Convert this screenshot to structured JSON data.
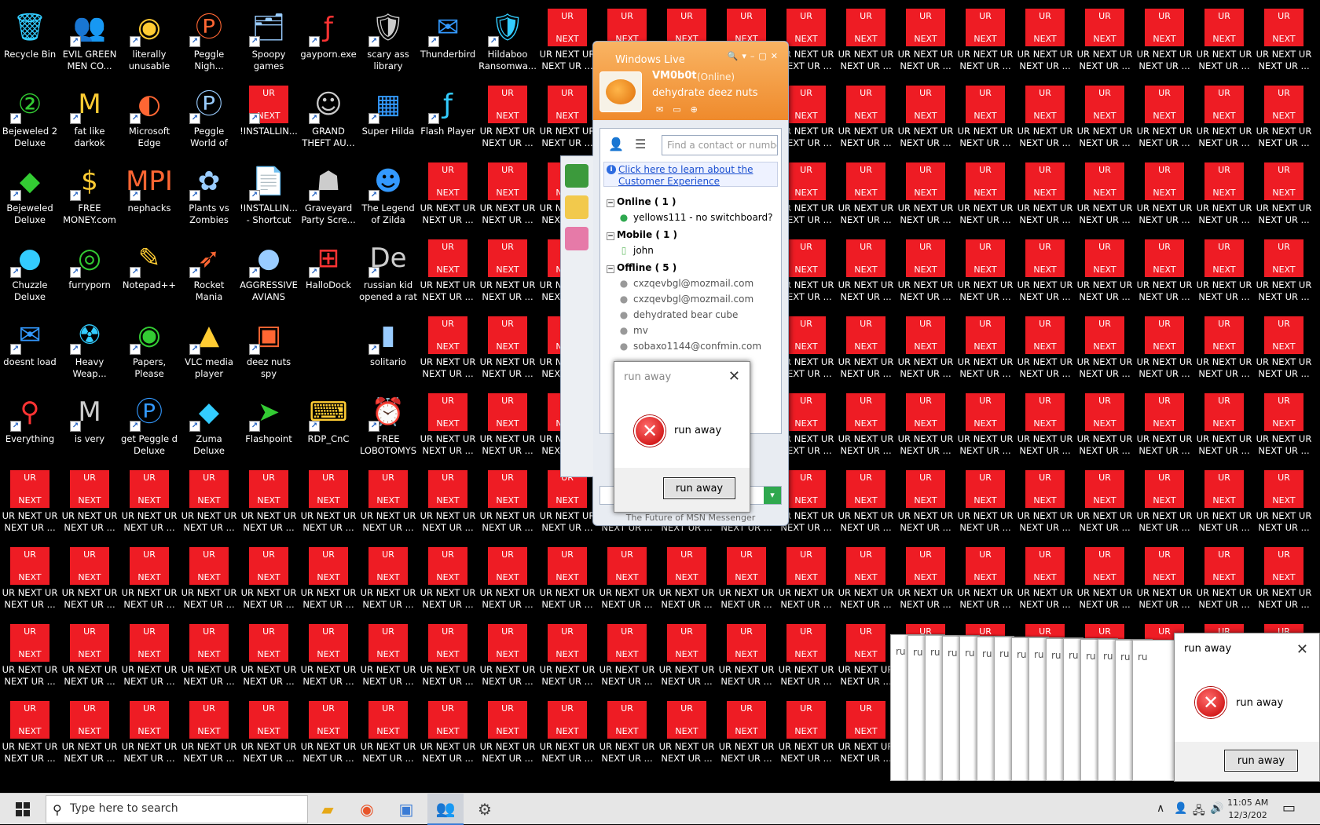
{
  "desktop_icons_named": [
    {
      "label": "Recycle Bin",
      "glyph": "🗑",
      "icon": "recycle-bin-icon",
      "c": 0,
      "r": 0,
      "shortcut": false
    },
    {
      "label": "EVIL GREEN MEN CO...",
      "glyph": "👥",
      "icon": "green-men-icon",
      "c": 1,
      "r": 0
    },
    {
      "label": "literally unusable",
      "glyph": "◉",
      "icon": "chrome-icon",
      "c": 2,
      "r": 0
    },
    {
      "label": "Peggle Nigh...",
      "glyph": "Ⓟ",
      "icon": "peggle-icon",
      "c": 3,
      "r": 0
    },
    {
      "label": "Spoopy games",
      "glyph": "🗂",
      "icon": "folder-icon",
      "c": 4,
      "r": 0
    },
    {
      "label": "gayporn.exe",
      "glyph": "ƒ",
      "icon": "flash-icon",
      "c": 5,
      "r": 0
    },
    {
      "label": "scary ass library",
      "glyph": "🛡",
      "icon": "library-icon",
      "c": 6,
      "r": 0
    },
    {
      "label": "Thunderbird",
      "glyph": "✉",
      "icon": "thunderbird-icon",
      "c": 7,
      "r": 0
    },
    {
      "label": "Hildaboo Ransomwa...",
      "glyph": "🛡",
      "icon": "yashma-icon",
      "c": 8,
      "r": 0
    },
    {
      "label": "Bejeweled 2 Deluxe",
      "glyph": "②",
      "icon": "bejeweled2-icon",
      "c": 0,
      "r": 1
    },
    {
      "label": "fat like darkok",
      "glyph": "M",
      "icon": "mahjong-icon",
      "c": 1,
      "r": 1
    },
    {
      "label": "Microsoft Edge",
      "glyph": "◐",
      "icon": "edge-icon",
      "c": 2,
      "r": 1
    },
    {
      "label": "Peggle World of Warcraft ...",
      "glyph": "Ⓟ",
      "icon": "peggle-wow-icon",
      "c": 3,
      "r": 1
    },
    {
      "label": "!INSTALLIN...",
      "glyph": "UR",
      "icon": "ur-next-icon",
      "c": 4,
      "r": 1
    },
    {
      "label": "GRAND THEFT AU...",
      "glyph": "☺",
      "icon": "anime-icon",
      "c": 5,
      "r": 1
    },
    {
      "label": "Super Hilda",
      "glyph": "▦",
      "icon": "pixel-icon",
      "c": 6,
      "r": 1
    },
    {
      "label": "Flash Player",
      "glyph": "ƒ",
      "icon": "flash-player-icon",
      "c": 7,
      "r": 1
    },
    {
      "label": "Bejeweled Deluxe",
      "glyph": "◆",
      "icon": "bejeweled-icon",
      "c": 0,
      "r": 2
    },
    {
      "label": "FREE MONEY.com",
      "glyph": "$",
      "icon": "money-bag-icon",
      "c": 1,
      "r": 2
    },
    {
      "label": "nephacks",
      "glyph": "MPI",
      "icon": "mpi-icon",
      "c": 2,
      "r": 2
    },
    {
      "label": "Plants vs Zombies",
      "glyph": "✿",
      "icon": "pvz-icon",
      "c": 3,
      "r": 2
    },
    {
      "label": "!INSTALLIN... - Shortcut",
      "glyph": "📄",
      "icon": "document-icon",
      "c": 4,
      "r": 2
    },
    {
      "label": "Graveyard Party Scre...",
      "glyph": "☗",
      "icon": "graveyard-icon",
      "c": 5,
      "r": 2
    },
    {
      "label": "The Legend of Zilda",
      "glyph": "☻",
      "icon": "zelda-icon",
      "c": 6,
      "r": 2
    },
    {
      "label": "Chuzzle Deluxe",
      "glyph": "●",
      "icon": "chuzzle-icon",
      "c": 0,
      "r": 3
    },
    {
      "label": "furryporn",
      "glyph": "◎",
      "icon": "firefox-icon",
      "c": 1,
      "r": 3
    },
    {
      "label": "Notepad++",
      "glyph": "✎",
      "icon": "notepad-icon",
      "c": 2,
      "r": 3
    },
    {
      "label": "Rocket Mania Deluxe",
      "glyph": "➶",
      "icon": "rocket-icon",
      "c": 3,
      "r": 3
    },
    {
      "label": "AGGRESSIVE AVIANS",
      "glyph": "●",
      "icon": "angry-birds-icon",
      "c": 4,
      "r": 3
    },
    {
      "label": "HalloDock",
      "glyph": "⊞",
      "icon": "windows-shield-icon",
      "c": 5,
      "r": 3
    },
    {
      "label": "russian kid opened a rat",
      "glyph": "De",
      "icon": "de-icon",
      "c": 6,
      "r": 3
    },
    {
      "label": "doesnt load",
      "glyph": "✉",
      "icon": "mail-icon",
      "c": 0,
      "r": 4
    },
    {
      "label": "Heavy Weap...",
      "glyph": "☢",
      "icon": "radiation-icon",
      "c": 1,
      "r": 4
    },
    {
      "label": "Papers, Please",
      "glyph": "◉",
      "icon": "papers-please-icon",
      "c": 2,
      "r": 4
    },
    {
      "label": "VLC media player",
      "glyph": "▲",
      "icon": "vlc-icon",
      "c": 3,
      "r": 4
    },
    {
      "label": "deez nuts spy",
      "glyph": "▣",
      "icon": "windows-stack-icon",
      "c": 4,
      "r": 4
    },
    {
      "label": "solitario",
      "glyph": "▮",
      "icon": "solitaire-icon",
      "c": 6,
      "r": 4
    },
    {
      "label": "Everything",
      "glyph": "⚲",
      "icon": "everything-icon",
      "c": 0,
      "r": 5
    },
    {
      "label": "is very",
      "glyph": "M",
      "icon": "mw-icon",
      "c": 1,
      "r": 5
    },
    {
      "label": "get Peggle d Deluxe",
      "glyph": "Ⓟ",
      "icon": "peggle-deluxe-icon",
      "c": 2,
      "r": 5
    },
    {
      "label": "Zuma Deluxe",
      "glyph": "◆",
      "icon": "zuma-icon",
      "c": 3,
      "r": 5
    },
    {
      "label": "Flashpoint",
      "glyph": "➤",
      "icon": "flashpoint-icon",
      "c": 4,
      "r": 5
    },
    {
      "label": "RDP_CnC",
      "glyph": "⌨",
      "icon": "rdp-icon",
      "c": 5,
      "r": 5
    },
    {
      "label": "FREE LOBOTOMYS",
      "glyph": "⏰",
      "icon": "alarm-icon",
      "c": 6,
      "r": 5
    }
  ],
  "ur_icon": {
    "top": "UR",
    "bottom": "NEXT",
    "label": "UR NEXT UR NEXT UR ..."
  },
  "messenger": {
    "title": "Windows Live",
    "username": "VM0b0t",
    "status": "(Online)",
    "personal_message": "dehydrate deez nuts",
    "search_placeholder": "Find a contact or number...",
    "banner": "Click here to learn about the Customer Experience",
    "groups": [
      {
        "label": "Online ( 1 )",
        "contacts": [
          {
            "name": "yellows111 - no switchboard?",
            "state": "online"
          }
        ]
      },
      {
        "label": "Mobile ( 1 )",
        "contacts": [
          {
            "name": "john",
            "state": "mobile"
          }
        ]
      },
      {
        "label": "Offline ( 5 )",
        "contacts": [
          {
            "name": "cxzqevbgl@mozmail.com",
            "state": "offline"
          },
          {
            "name": "cxzqevbgl@mozmail.com",
            "state": "offline"
          },
          {
            "name": "dehydrated bear cube",
            "state": "offline"
          },
          {
            "name": "mv",
            "state": "offline"
          },
          {
            "name": "sobaxo1144@confmin.com",
            "state": "offline"
          }
        ]
      }
    ],
    "footer": "The Future of MSN Messenger"
  },
  "dialog_center": {
    "title": "run away",
    "message": "run away",
    "button": "run away"
  },
  "dialog_right": {
    "title": "run away",
    "message": "run away",
    "button": "run away"
  },
  "stack_title": "ru",
  "taskbar": {
    "search_placeholder": "Type here to search",
    "clock_time": "11:05 AM",
    "clock_date": "12/3/202"
  },
  "colors": {
    "ur_red": "#ee1c24",
    "msn_orange": "#f29a3c",
    "taskbar": "#e6e6e6"
  }
}
